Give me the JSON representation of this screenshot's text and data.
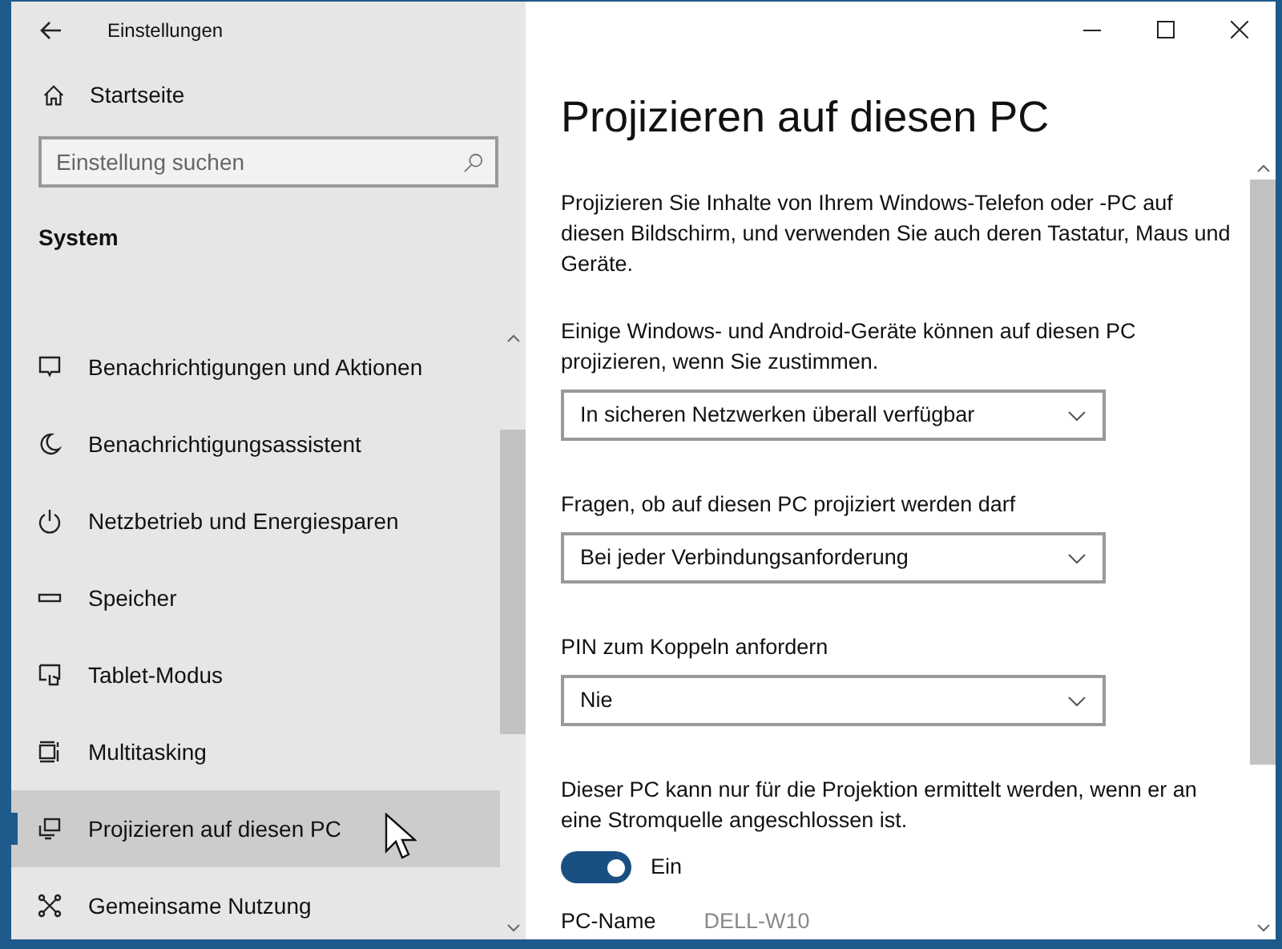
{
  "window": {
    "title": "Einstellungen"
  },
  "sidebar": {
    "home": "Startseite",
    "search": {
      "placeholder": "Einstellung suchen"
    },
    "section": "System",
    "items": [
      {
        "label": "Benachrichtigungen und Aktionen",
        "selected": false
      },
      {
        "label": "Benachrichtigungsassistent",
        "selected": false
      },
      {
        "label": "Netzbetrieb und Energiesparen",
        "selected": false
      },
      {
        "label": "Speicher",
        "selected": false
      },
      {
        "label": "Tablet-Modus",
        "selected": false
      },
      {
        "label": "Multitasking",
        "selected": false
      },
      {
        "label": "Projizieren auf diesen PC",
        "selected": true
      },
      {
        "label": "Gemeinsame Nutzung",
        "selected": false
      }
    ]
  },
  "content": {
    "title": "Projizieren auf diesen PC",
    "description": "Projizieren Sie Inhalte von Ihrem Windows-Telefon oder -PC auf diesen Bildschirm, und verwenden Sie auch deren Tastatur, Maus und Geräte.",
    "settings": [
      {
        "kind": "dropdown",
        "label": "Einige Windows- und Android-Geräte können auf diesen PC projizieren, wenn Sie zustimmen.",
        "value": "In sicheren Netzwerken überall verfügbar"
      },
      {
        "kind": "dropdown",
        "label": "Fragen, ob auf diesen PC projiziert werden darf",
        "value": "Bei jeder Verbindungsanforderung"
      },
      {
        "kind": "dropdown",
        "label": "PIN zum Koppeln anfordern",
        "value": "Nie"
      },
      {
        "kind": "toggle",
        "label": "Dieser PC kann nur für die Projektion ermittelt werden, wenn er an eine Stromquelle angeschlossen ist.",
        "on": true,
        "state_text": "Ein"
      }
    ],
    "pc_name": {
      "label": "PC-Name",
      "value": "DELL-W10"
    }
  }
}
